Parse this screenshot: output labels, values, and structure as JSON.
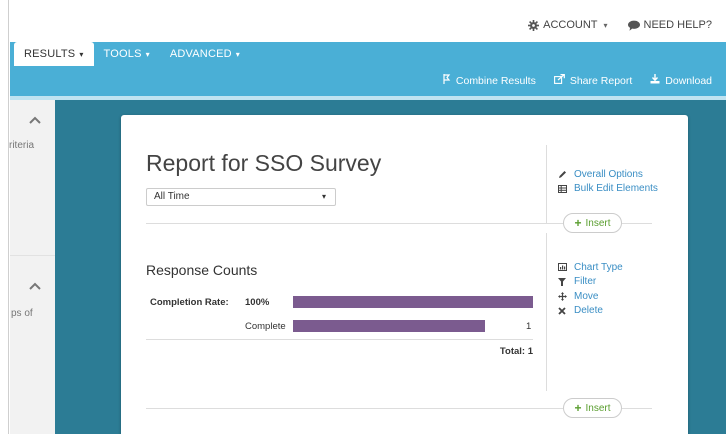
{
  "topbar": {
    "account_label": "ACCOUNT",
    "help_label": "NEED HELP?"
  },
  "nav": {
    "tabs": [
      {
        "label": "RESULTS",
        "active": true
      },
      {
        "label": "TOOLS",
        "active": false
      },
      {
        "label": "ADVANCED",
        "active": false
      }
    ],
    "actions": [
      {
        "label": "Combine Results",
        "icon": "combine-icon"
      },
      {
        "label": "Share Report",
        "icon": "share-icon"
      },
      {
        "label": "Download",
        "icon": "download-icon"
      }
    ]
  },
  "left_panel": {
    "text_1": "criteria",
    "text_2": "ps of"
  },
  "report": {
    "title": "Report for SSO Survey",
    "date_filter": "All Time",
    "report_options": [
      {
        "label": "Overall Options",
        "icon": "pencil-icon"
      },
      {
        "label": "Bulk Edit Elements",
        "icon": "table-icon"
      }
    ],
    "insert_label": "Insert",
    "element_options": [
      {
        "label": "Chart Type",
        "icon": "chart-icon"
      },
      {
        "label": "Filter",
        "icon": "filter-icon"
      },
      {
        "label": "Move",
        "icon": "move-icon"
      },
      {
        "label": "Delete",
        "icon": "delete-icon"
      }
    ]
  },
  "response_counts": {
    "title": "Response Counts",
    "completion_label": "Completion Rate:",
    "completion_value": "100%",
    "completion_fraction": 1.0,
    "rows": [
      {
        "label": "Complete",
        "count": "1",
        "fraction": 0.8
      }
    ],
    "total_label": "Total: 1"
  },
  "colors": {
    "nav_blue": "#4aafd6",
    "main_bg": "#2c7c95",
    "bar": "#7b5b8f",
    "link": "#3a8ec4",
    "insert_green": "#5a9e2f"
  }
}
